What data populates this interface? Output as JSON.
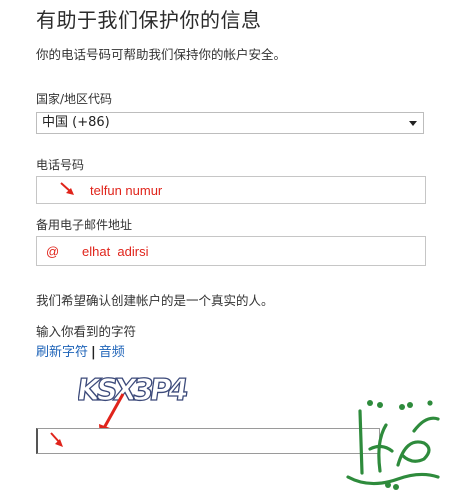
{
  "page": {
    "title": "有助于我们保护你的信息",
    "subtitle": "你的电话号码可帮助我们保持你的帐户安全。"
  },
  "country": {
    "label": "国家/地区代码",
    "selected": "中国 (+86)"
  },
  "phone": {
    "label": "电话号码",
    "annotation": "telfun numur"
  },
  "email": {
    "label": "备用电子邮件地址",
    "annotation_at": "@",
    "annotation": "elhat  adirsi"
  },
  "verify": {
    "text": "我们希望确认创建帐户的是一个真实的人。",
    "captcha_prompt": "输入你看到的字符",
    "refresh_link": "刷新字符",
    "separator": "|",
    "audio_link": "音频",
    "captcha_text": "KSX3P4"
  },
  "colors": {
    "annotation_red": "#e0241b",
    "link_blue": "#1e63b8",
    "watermark_green": "#2e8b3c"
  }
}
